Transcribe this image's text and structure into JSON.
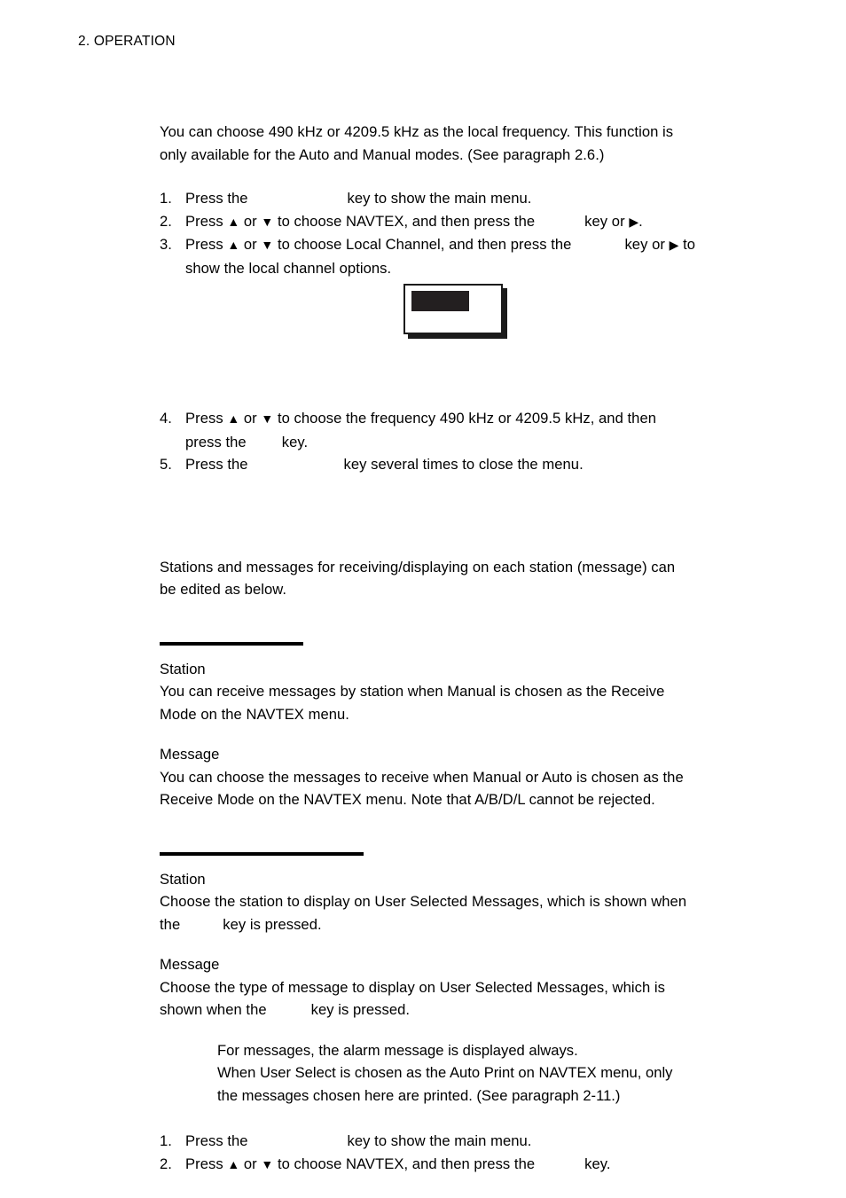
{
  "header": {
    "chapter": "2. OPERATION"
  },
  "intro": {
    "line1": "You can choose 490 kHz or 4209.5 kHz as the local frequency. This function is",
    "line2": "only available for the Auto and Manual modes. (See paragraph 2.6.)"
  },
  "steps_local_channel": [
    {
      "num": "1.",
      "part1": "Press the",
      "part2": "key to show the main menu."
    },
    {
      "num": "2.",
      "part1": "Press",
      "up": "▲",
      "or": "or",
      "down": "▼",
      "part2": "to choose NAVTEX, and then press the",
      "part3": "key or",
      "right": "▶",
      "part4": "."
    },
    {
      "num": "3.",
      "part1": "Press",
      "up": "▲",
      "or": "or",
      "down": "▼",
      "part2": "to choose Local Channel, and then press the",
      "part3": "key or",
      "right": "▶",
      "part4": "to",
      "line2": "show the local channel options."
    },
    {
      "num": "4.",
      "part1": "Press",
      "up": "▲",
      "or": "or",
      "down": "▼",
      "part2": "to choose the frequency 490 kHz or 4209.5 kHz, and then",
      "line2a": "press the",
      "line2b": "key."
    },
    {
      "num": "5.",
      "part1": "Press the",
      "part2": "key several times to close the menu."
    }
  ],
  "figure": {
    "caption": ""
  },
  "stations_intro": {
    "line1": "Stations and messages for receiving/displaying on each station (message) can",
    "line2": "be edited as below."
  },
  "section_one": {
    "rule": "",
    "station_head": "Station",
    "station_body_line1": "You can receive messages by station when Manual is chosen as the Receive",
    "station_body_line2": "Mode on the NAVTEX menu.",
    "message_head": "Message",
    "message_body_line1": "You can choose the messages to receive when Manual or Auto is chosen as the",
    "message_body_line2": "Receive Mode on the NAVTEX menu. Note that A/B/D/L cannot be rejected."
  },
  "section_two": {
    "rule": "",
    "station_head": "Station",
    "station_body_line1": "Choose the station to display on User Selected Messages, which is shown when",
    "station_body_line2a": "the",
    "station_body_line2b": "key is pressed.",
    "message_head": "Message",
    "message_body_line1": "Choose the type of message to display on User Selected Messages, which is",
    "message_body_line2a": "shown when the",
    "message_body_line2b": "key is pressed."
  },
  "note": {
    "line1": "For messages, the alarm message is displayed always.",
    "line2": "When User Select is chosen as the Auto Print on NAVTEX menu, only",
    "line3": "the messages chosen here are printed. (See paragraph 2-11.)"
  },
  "steps_user_select": [
    {
      "num": "1.",
      "part1": "Press the",
      "part2": "key to show the main menu."
    },
    {
      "num": "2.",
      "part1": "Press",
      "up": "▲",
      "or": "or",
      "down": "▼",
      "part2": "to choose NAVTEX, and then press the",
      "part3": "key."
    }
  ],
  "colors": {
    "text": "#000000",
    "rule": "#000000",
    "figure_fill": "#231f20",
    "page_background": "#ffffff"
  }
}
